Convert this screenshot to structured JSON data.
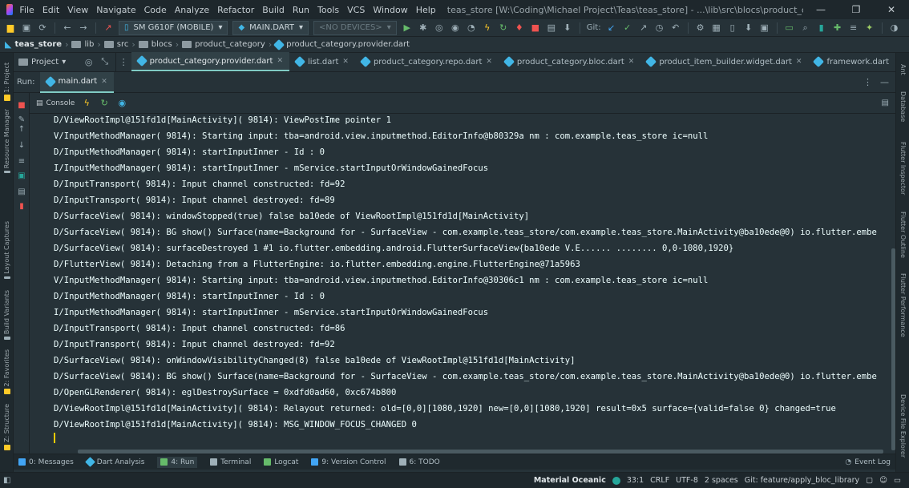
{
  "window": {
    "title": "teas_store [W:\\Coding\\Michael Project\\Teas\\teas_store] - ...\\lib\\src\\blocs\\product_category\\product_category.provider.dart - IntelliJ IDEA",
    "controls": [
      "—",
      "❐",
      "✕"
    ]
  },
  "menu": [
    "File",
    "Edit",
    "View",
    "Navigate",
    "Code",
    "Analyze",
    "Refactor",
    "Build",
    "Run",
    "Tools",
    "VCS",
    "Window",
    "Help"
  ],
  "toolbar": {
    "device": "SM G610F (MOBILE)",
    "run_config": "MAIN.DART",
    "no_devices": "<NO DEVICES>",
    "vcs_label": "Git:"
  },
  "breadcrumb": [
    "teas_store",
    "lib",
    "src",
    "blocs",
    "product_category",
    "product_category.provider.dart"
  ],
  "project_pane": {
    "label": "Project"
  },
  "editor_tabs": [
    {
      "label": "product_category.provider.dart",
      "active": true
    },
    {
      "label": "list.dart",
      "active": false
    },
    {
      "label": "product_category.repo.dart",
      "active": false
    },
    {
      "label": "product_category.bloc.dart",
      "active": false
    },
    {
      "label": "product_item_builder.widget.dart",
      "active": false
    },
    {
      "label": "framework.dart",
      "active": false
    }
  ],
  "run_panel": {
    "label": "Run:",
    "tab": "main.dart",
    "console_tab": "Console"
  },
  "console": {
    "lines": [
      "D/ViewRootImpl@151fd1d[MainActivity]( 9814): ViewPostIme pointer 1",
      "V/InputMethodManager( 9814): Starting input: tba=android.view.inputmethod.EditorInfo@b80329a nm : com.example.teas_store ic=null",
      "D/InputMethodManager( 9814): startInputInner - Id : 0",
      "I/InputMethodManager( 9814): startInputInner - mService.startInputOrWindowGainedFocus",
      "D/InputTransport( 9814): Input channel constructed: fd=92",
      "D/InputTransport( 9814): Input channel destroyed: fd=89",
      "D/SurfaceView( 9814): windowStopped(true) false ba10ede of ViewRootImpl@151fd1d[MainActivity]",
      "D/SurfaceView( 9814): BG show() Surface(name=Background for - SurfaceView - com.example.teas_store/com.example.teas_store.MainActivity@ba10ede@0) io.flutter.embe",
      "D/SurfaceView( 9814): surfaceDestroyed 1 #1 io.flutter.embedding.android.FlutterSurfaceView{ba10ede V.E...... ........ 0,0-1080,1920}",
      "D/FlutterView( 9814): Detaching from a FlutterEngine: io.flutter.embedding.engine.FlutterEngine@71a5963",
      "V/InputMethodManager( 9814): Starting input: tba=android.view.inputmethod.EditorInfo@30306c1 nm : com.example.teas_store ic=null",
      "D/InputMethodManager( 9814): startInputInner - Id : 0",
      "I/InputMethodManager( 9814): startInputInner - mService.startInputOrWindowGainedFocus",
      "D/InputTransport( 9814): Input channel constructed: fd=86",
      "D/InputTransport( 9814): Input channel destroyed: fd=92",
      "D/SurfaceView( 9814): onWindowVisibilityChanged(8) false ba10ede of ViewRootImpl@151fd1d[MainActivity]",
      "D/SurfaceView( 9814): BG show() Surface(name=Background for - SurfaceView - com.example.teas_store/com.example.teas_store.MainActivity@ba10ede@0) io.flutter.embe",
      "D/OpenGLRenderer( 9814): eglDestroySurface = 0xdfd0ad60, 0xc674b800",
      "D/ViewRootImpl@151fd1d[MainActivity]( 9814): Relayout returned: old=[0,0][1080,1920] new=[0,0][1080,1920] result=0x5 surface={valid=false 0} changed=true",
      "D/ViewRootImpl@151fd1d[MainActivity]( 9814): MSG_WINDOW_FOCUS_CHANGED 0"
    ]
  },
  "left_stripe": [
    {
      "label": "1: Project",
      "color": "#ffca28"
    },
    {
      "label": "Resource Manager",
      "color": "#9fb0b8"
    },
    {
      "label": "Layout Captures",
      "color": "#9fb0b8"
    },
    {
      "label": "Build Variants",
      "color": "#9fb0b8"
    },
    {
      "label": "2: Favorites",
      "color": "#ffca28"
    },
    {
      "label": "Z: Structure",
      "color": "#ffca28"
    }
  ],
  "right_stripe": [
    "Ant",
    "Database",
    "Flutter Inspector",
    "Flutter Outline",
    "Flutter Performance",
    "Device File Explorer"
  ],
  "bottom_tools": [
    {
      "label": "0: Messages",
      "color": "#42a5f5",
      "active": false
    },
    {
      "label": "Dart Analysis",
      "color": "#41b6e6",
      "active": false
    },
    {
      "label": "4: Run",
      "color": "#66bb6a",
      "active": true
    },
    {
      "label": "Terminal",
      "color": "#9fb0b8",
      "active": false
    },
    {
      "label": "Logcat",
      "color": "#66bb6a",
      "active": false
    },
    {
      "label": "9: Version Control",
      "color": "#42a5f5",
      "active": false
    },
    {
      "label": "6: TODO",
      "color": "#9fb0b8",
      "active": false
    }
  ],
  "event_log": "Event Log",
  "status": {
    "theme": "Material Oceanic",
    "position": "33:1",
    "line_sep": "CRLF",
    "encoding": "UTF-8",
    "indent": "2 spaces",
    "branch": "Git: feature/apply_bloc_library"
  }
}
